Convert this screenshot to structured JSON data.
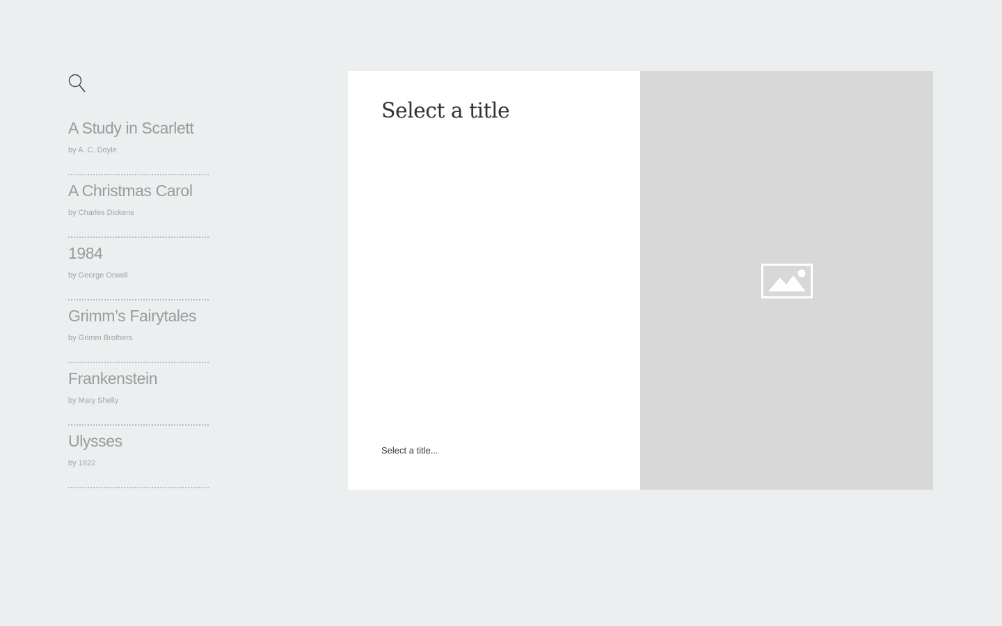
{
  "sidebar": {
    "search_icon": "search-icon",
    "books": [
      {
        "title": "A Study in Scarlett",
        "author": "by A. C. Doyle"
      },
      {
        "title": "A Christmas Carol",
        "author": "by Charles Dickens"
      },
      {
        "title": "1984",
        "author": "by George Orwell"
      },
      {
        "title": "Grimm’s Fairytales",
        "author": "by Grimm Brothers"
      },
      {
        "title": "Frankenstein",
        "author": "by Mary Shelly"
      },
      {
        "title": "Ulysses",
        "author": "by 1922"
      }
    ]
  },
  "detail": {
    "title": "Select a title",
    "description": "Select a title..."
  },
  "cover": {
    "placeholder_icon": "image-placeholder-icon"
  },
  "colors": {
    "background": "#ebeff0",
    "card": "#ffffff",
    "cover_placeholder": "#d8d8d8",
    "title_text": "#333333",
    "list_text": "#9b9b9b"
  }
}
